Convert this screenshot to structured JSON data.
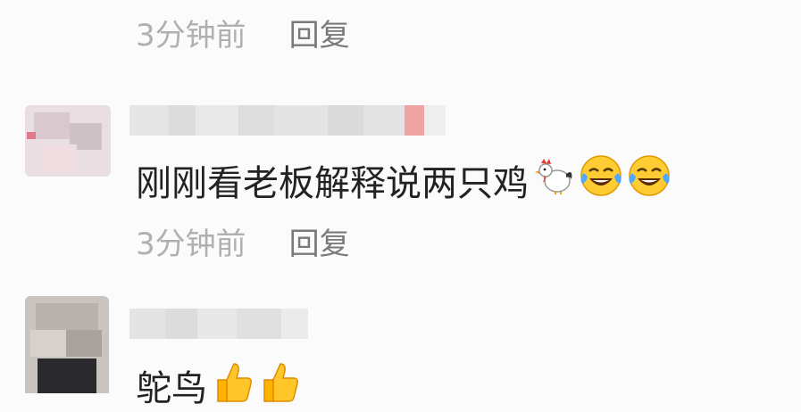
{
  "comments": [
    {
      "time": "3分钟前",
      "reply_label": "回复"
    },
    {
      "text": "刚刚看老板解释说两只鸡",
      "emoji_icons": [
        "rooster-icon",
        "tears-of-joy-icon",
        "tears-of-joy-icon"
      ],
      "time": "3分钟前",
      "reply_label": "回复"
    },
    {
      "text": "鸵鸟",
      "emoji_icons": [
        "thumbs-up-icon",
        "thumbs-up-icon"
      ]
    }
  ]
}
